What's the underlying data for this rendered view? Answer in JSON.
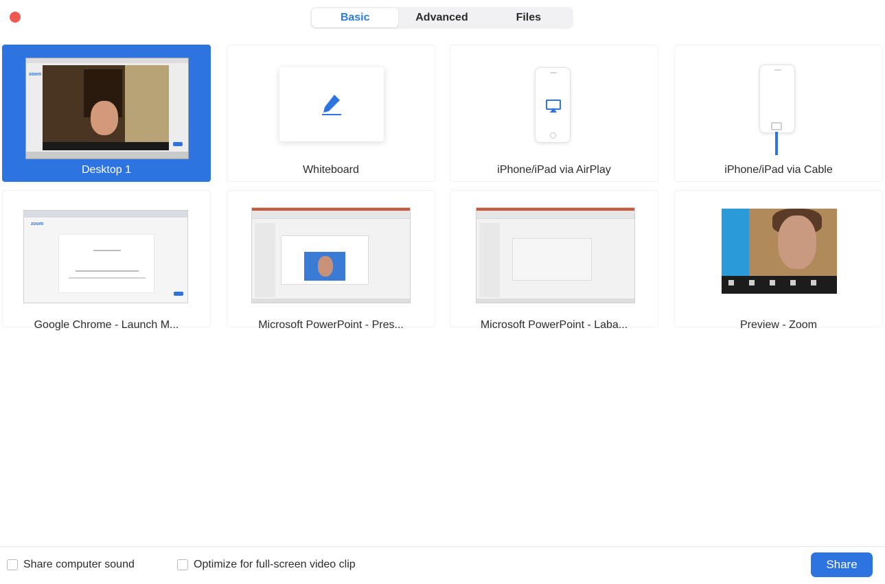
{
  "window": {
    "close_color": "#ee5a52"
  },
  "tabs": [
    {
      "label": "Basic",
      "active": true
    },
    {
      "label": "Advanced",
      "active": false
    },
    {
      "label": "Files",
      "active": false
    }
  ],
  "sources": [
    {
      "label": "Desktop 1",
      "selected": true,
      "thumb": "desktop-screenshot"
    },
    {
      "label": "Whiteboard",
      "selected": false,
      "thumb": "pencil-icon"
    },
    {
      "label": "iPhone/iPad via AirPlay",
      "selected": false,
      "thumb": "airplay-icon"
    },
    {
      "label": "iPhone/iPad via Cable",
      "selected": false,
      "thumb": "cable-icon"
    },
    {
      "label": "Google Chrome - Launch M...",
      "selected": false,
      "thumb": "chrome-window"
    },
    {
      "label": "Microsoft PowerPoint - Pres...",
      "selected": false,
      "thumb": "powerpoint-window"
    },
    {
      "label": "Microsoft PowerPoint - Laba...",
      "selected": false,
      "thumb": "powerpoint-window"
    },
    {
      "label": "Preview - Zoom",
      "selected": false,
      "thumb": "preview-window"
    }
  ],
  "desktop_thumb": {
    "app_text": "zoom"
  },
  "chrome_thumb": {
    "app_text": "zoom"
  },
  "footer": {
    "share_sound_label": "Share computer sound",
    "optimize_label": "Optimize for full-screen video clip",
    "share_button": "Share"
  },
  "colors": {
    "accent": "#2d74e0",
    "tab_active_text": "#2d7be5",
    "selected_bg": "#2d74e0"
  }
}
